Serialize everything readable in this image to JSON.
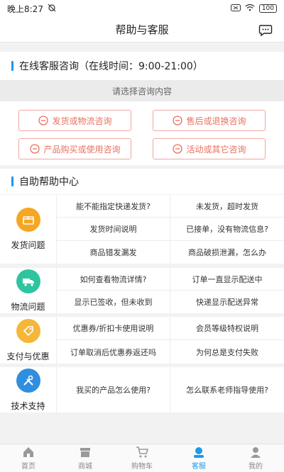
{
  "status": {
    "time": "晚上8:27",
    "battery": "100"
  },
  "nav": {
    "title": "帮助与客服"
  },
  "online": {
    "title": "在线客服咨询（在线时间：9:00-21:00）",
    "prompt": "请选择咨询内容",
    "buttons": [
      "发货或物流咨询",
      "售后或退换咨询",
      "产品购买或使用咨询",
      "活动或其它咨询"
    ]
  },
  "self_help": {
    "title": "自助帮助中心",
    "categories": [
      {
        "label": "发货问题",
        "icon": "box-icon",
        "color": "#f5a623",
        "questions": [
          "能不能指定快递发货?",
          "未发货，超时发货",
          "发货时间说明",
          "已接单，没有物流信息?",
          "商品错发漏发",
          "商品破损泄漏，怎么办"
        ]
      },
      {
        "label": "物流问题",
        "icon": "truck-icon",
        "color": "#2ec4a0",
        "questions": [
          "如何查看物流详情?",
          "订单一直显示配送中",
          "显示已签收，但未收到",
          "快递显示配送异常"
        ]
      },
      {
        "label": "支付与优惠",
        "icon": "tag-icon",
        "color": "#f5b63a",
        "questions": [
          "优惠券/折扣卡使用说明",
          "会员等级特权说明",
          "订单取消后优惠券返还吗",
          "为何总是支付失败"
        ]
      },
      {
        "label": "技术支持",
        "icon": "tools-icon",
        "color": "#2f8ee0",
        "questions": [
          "我买的产品怎么使用?",
          "怎么联系老师指导使用?"
        ]
      }
    ]
  },
  "tabs": [
    {
      "label": "首页",
      "icon": "home-icon"
    },
    {
      "label": "商城",
      "icon": "shop-icon"
    },
    {
      "label": "购物车",
      "icon": "cart-icon"
    },
    {
      "label": "客服",
      "icon": "service-icon",
      "active": true
    },
    {
      "label": "我的",
      "icon": "user-icon"
    }
  ]
}
